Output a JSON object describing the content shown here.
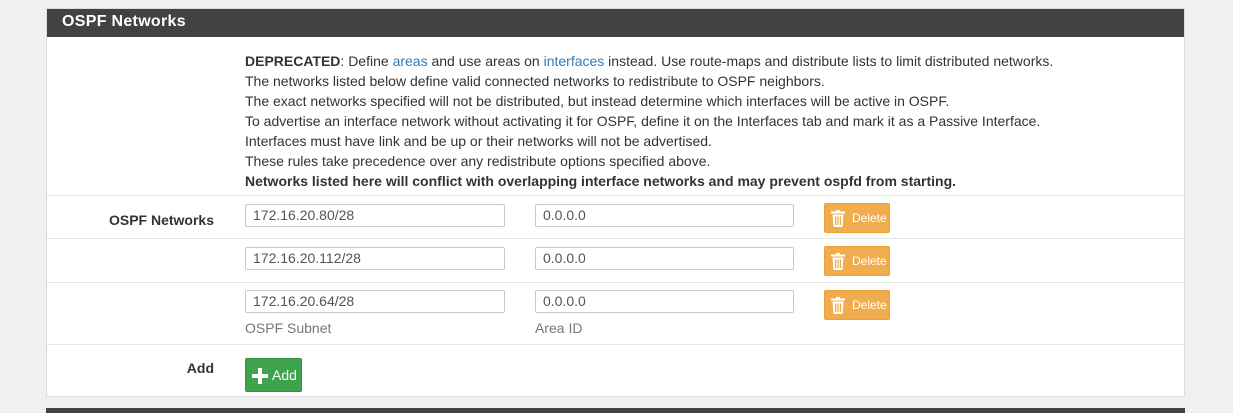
{
  "section": {
    "title": "OSPF Networks"
  },
  "help": {
    "line1_bold": "DEPRECATED",
    "line1_a": ": Define ",
    "link_areas": "areas",
    "line1_b": " and use areas on ",
    "link_interfaces": "interfaces",
    "line1_c": " instead. Use route-maps and distribute lists to limit distributed networks.",
    "line2": "The networks listed below define valid connected networks to redistribute to OSPF neighbors.",
    "line3": "The exact networks specified will not be distributed, but instead determine which interfaces will be active in OSPF.",
    "line4": "To advertise an interface network without activating it for OSPF, define it on the Interfaces tab and mark it as a Passive Interface.",
    "line5": "Interfaces must have link and be up or their networks will not be advertised.",
    "line6": "These rules take precedence over any redistribute options specified above.",
    "line7_bold": "Networks listed here will conflict with overlapping interface networks and may prevent ospfd from starting."
  },
  "networks": {
    "label": "OSPF Networks",
    "delete_label": "Delete",
    "subnet_hint": "OSPF Subnet",
    "area_hint": "Area ID",
    "rows": [
      {
        "subnet": "172.16.20.80/28",
        "area": "0.0.0.0"
      },
      {
        "subnet": "172.16.20.112/28",
        "area": "0.0.0.0"
      },
      {
        "subnet": "172.16.20.64/28",
        "area": "0.0.0.0"
      }
    ]
  },
  "add": {
    "label": "Add",
    "button_label": "Add"
  },
  "icons": {
    "delete": "trash-icon",
    "add": "plus-icon"
  },
  "colors": {
    "heading": "#424242",
    "delete": "#f0ad4e",
    "add": "#3fa34d",
    "link": "#337ab7"
  }
}
